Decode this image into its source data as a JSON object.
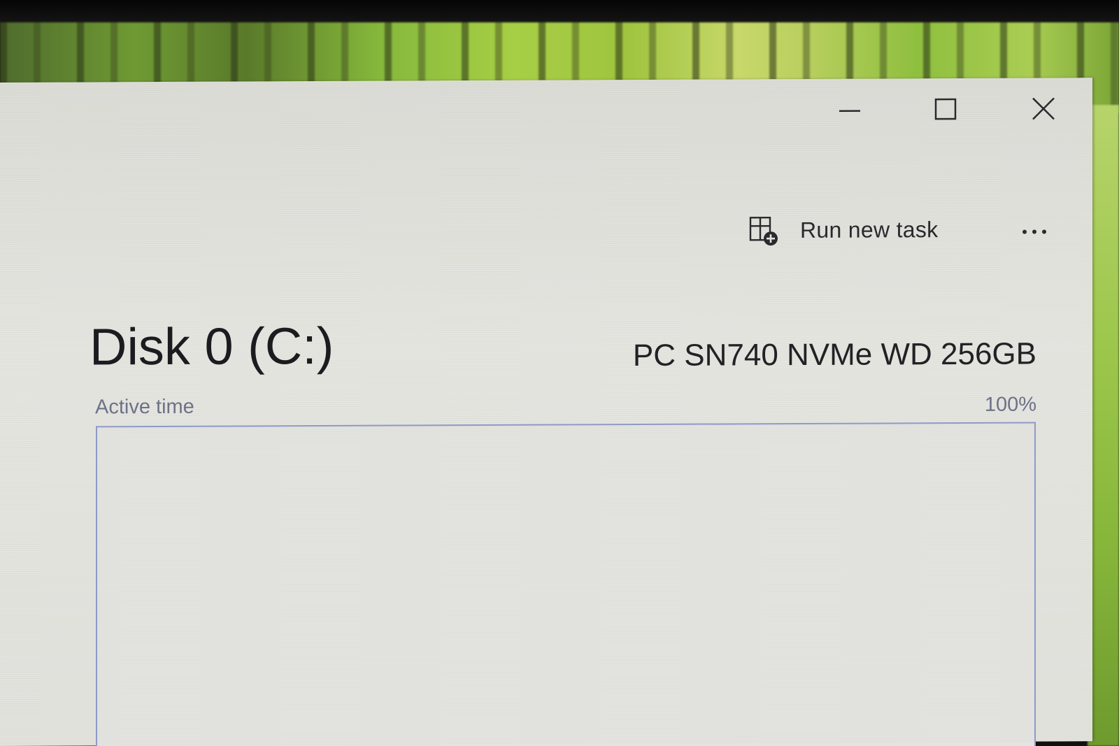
{
  "window": {
    "minimize_label": "Minimize",
    "maximize_label": "Maximize",
    "close_label": "Close"
  },
  "toolbar": {
    "run_new_task_label": "Run new task",
    "more_options_label": "More options"
  },
  "disk": {
    "title": "Disk 0 (C:)",
    "model": "PC SN740 NVMe WD 256GB"
  },
  "active_time_chart": {
    "label": "Active time",
    "max_label": "100%",
    "max_value": 100,
    "grid": false
  },
  "colors": {
    "chart_border": "#8f9bc9",
    "window_background": "#e3e3df",
    "text_primary": "#1c1c20",
    "text_secondary": "#6e7386"
  }
}
